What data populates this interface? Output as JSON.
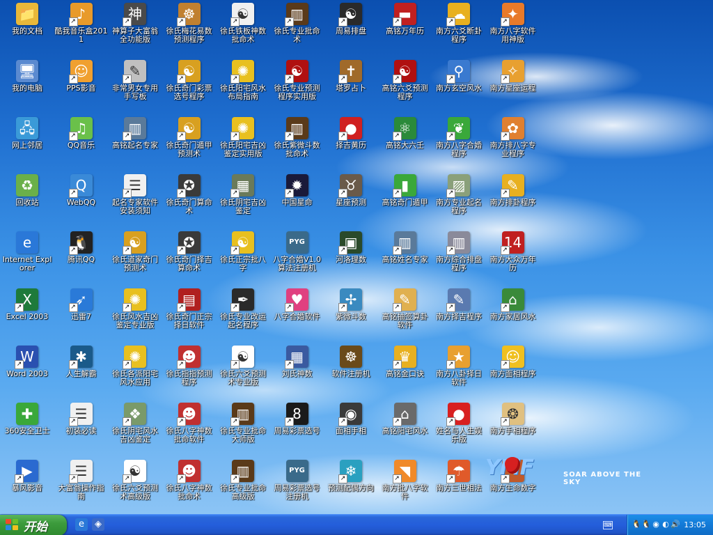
{
  "desktop": {
    "icons": [
      {
        "label": "我的文档",
        "glyph": "📁",
        "color": "#e8b83a",
        "col": 0,
        "row": 0,
        "shortcut": false
      },
      {
        "label": "我的电脑",
        "glyph": "🖥",
        "color": "#5a8ad0",
        "col": 0,
        "row": 1,
        "shortcut": false
      },
      {
        "label": "网上邻居",
        "glyph": "🖧",
        "color": "#3a9ad8",
        "col": 0,
        "row": 2,
        "shortcut": false
      },
      {
        "label": "回收站",
        "glyph": "♻",
        "color": "#6ab04a",
        "col": 0,
        "row": 3,
        "shortcut": false
      },
      {
        "label": "Internet Explorer",
        "glyph": "e",
        "color": "#2a78d8",
        "col": 0,
        "row": 4,
        "shortcut": false
      },
      {
        "label": "Excel 2003",
        "glyph": "X",
        "color": "#1e7a3a",
        "col": 0,
        "row": 5,
        "shortcut": true
      },
      {
        "label": "Word 2003",
        "glyph": "W",
        "color": "#2a50b0",
        "col": 0,
        "row": 6,
        "shortcut": true
      },
      {
        "label": "360安全卫士",
        "glyph": "✚",
        "color": "#3aa83a",
        "col": 0,
        "row": 7,
        "shortcut": false
      },
      {
        "label": "暴风影音",
        "glyph": "▶",
        "color": "#2a6ad0",
        "col": 0,
        "row": 8,
        "shortcut": true
      },
      {
        "label": "酷我音乐盒2011",
        "glyph": "♪",
        "color": "#e89a2a",
        "col": 1,
        "row": 0,
        "shortcut": true
      },
      {
        "label": "PPS影音",
        "glyph": "☺",
        "color": "#f0a030",
        "col": 1,
        "row": 1,
        "shortcut": true
      },
      {
        "label": "QQ音乐",
        "glyph": "♫",
        "color": "#6ac04a",
        "col": 1,
        "row": 2,
        "shortcut": true
      },
      {
        "label": "WebQQ",
        "glyph": "Q",
        "color": "#3a8ad8",
        "col": 1,
        "row": 3,
        "shortcut": true
      },
      {
        "label": "腾讯QQ",
        "glyph": "🐧",
        "color": "#222222",
        "col": 1,
        "row": 4,
        "shortcut": true
      },
      {
        "label": "迅雷7",
        "glyph": "➶",
        "color": "#2a7ad8",
        "col": 1,
        "row": 5,
        "shortcut": true
      },
      {
        "label": "人生解霸",
        "glyph": "✱",
        "color": "#1a5a8a",
        "col": 1,
        "row": 6,
        "shortcut": true
      },
      {
        "label": "初装必读",
        "glyph": "☰",
        "color": "#f0f0f0",
        "col": 1,
        "row": 7,
        "shortcut": true
      },
      {
        "label": "大富翁操作指南",
        "glyph": "☰",
        "color": "#f0f0f0",
        "col": 1,
        "row": 8,
        "shortcut": true
      },
      {
        "label": "神算子大富翁全功能版",
        "glyph": "神",
        "color": "#4a4a4a",
        "col": 2,
        "row": 0,
        "shortcut": true
      },
      {
        "label": "非常男女专用手写板",
        "glyph": "✎",
        "color": "#c0c0c0",
        "col": 2,
        "row": 1,
        "shortcut": true
      },
      {
        "label": "高铭起名专家",
        "glyph": "▥",
        "color": "#5a7a9a",
        "col": 2,
        "row": 2,
        "shortcut": true
      },
      {
        "label": "起名专家软件安装须知",
        "glyph": "☰",
        "color": "#f0f0f0",
        "col": 2,
        "row": 3,
        "shortcut": true
      },
      {
        "label": "徐氏道家奇门预测术",
        "glyph": "☯",
        "color": "#d8a020",
        "col": 2,
        "row": 4,
        "shortcut": true
      },
      {
        "label": "徐氏风水吉凶鉴定专业版",
        "glyph": "✺",
        "color": "#e8c020",
        "col": 2,
        "row": 5,
        "shortcut": true
      },
      {
        "label": "徐氏各派阳宅风水应用",
        "glyph": "✺",
        "color": "#e8c020",
        "col": 2,
        "row": 6,
        "shortcut": true
      },
      {
        "label": "徐氏阴宅风水吉凶鉴定",
        "glyph": "❖",
        "color": "#7a9a6a",
        "col": 2,
        "row": 7,
        "shortcut": true
      },
      {
        "label": "徐氏六爻预测术高级版",
        "glyph": "☯",
        "color": "#ffffff",
        "col": 2,
        "row": 8,
        "shortcut": true
      },
      {
        "label": "徐氏梅花易数预测程序",
        "glyph": "☸",
        "color": "#c08030",
        "col": 3,
        "row": 0,
        "shortcut": true
      },
      {
        "label": "徐氏奇门彩票选号程序",
        "glyph": "☯",
        "color": "#d8a020",
        "col": 3,
        "row": 1,
        "shortcut": true
      },
      {
        "label": "徐氏奇门遁甲预测术",
        "glyph": "☯",
        "color": "#d8a020",
        "col": 3,
        "row": 2,
        "shortcut": true
      },
      {
        "label": "徐氏奇门算命术",
        "glyph": "✪",
        "color": "#3a3a3a",
        "col": 3,
        "row": 3,
        "shortcut": true
      },
      {
        "label": "徐氏奇门择吉算命术",
        "glyph": "✪",
        "color": "#3a3a3a",
        "col": 3,
        "row": 4,
        "shortcut": true
      },
      {
        "label": "徐氏奇门正宗择日软件",
        "glyph": "▤",
        "color": "#b02020",
        "col": 3,
        "row": 5,
        "shortcut": true
      },
      {
        "label": "徐氏指指预测程序",
        "glyph": "☻",
        "color": "#c03030",
        "col": 3,
        "row": 6,
        "shortcut": true
      },
      {
        "label": "徐氏八字神数批命软件",
        "glyph": "☻",
        "color": "#c03030",
        "col": 3,
        "row": 7,
        "shortcut": true
      },
      {
        "label": "徐氏八字神数批命术",
        "glyph": "☻",
        "color": "#c03030",
        "col": 3,
        "row": 8,
        "shortcut": true
      },
      {
        "label": "徐氏铁板神数批命术",
        "glyph": "☯",
        "color": "#f0f0f0",
        "col": 4,
        "row": 0,
        "shortcut": true
      },
      {
        "label": "徐氏阳宅风水布局指南",
        "glyph": "✺",
        "color": "#e8c020",
        "col": 4,
        "row": 1,
        "shortcut": true
      },
      {
        "label": "徐氏阳宅吉凶鉴定实用版",
        "glyph": "✺",
        "color": "#e8c020",
        "col": 4,
        "row": 2,
        "shortcut": true
      },
      {
        "label": "徐氏阴宅吉凶鉴定",
        "glyph": "▦",
        "color": "#6a7a5a",
        "col": 4,
        "row": 3,
        "shortcut": true
      },
      {
        "label": "徐氏正宗批八字",
        "glyph": "☯",
        "color": "#e8c020",
        "col": 4,
        "row": 4,
        "shortcut": true
      },
      {
        "label": "徐氏专业改运起名程序",
        "glyph": "✒",
        "color": "#2a2a2a",
        "col": 4,
        "row": 5,
        "shortcut": true
      },
      {
        "label": "徐氏六爻预测术专业版",
        "glyph": "☯",
        "color": "#ffffff",
        "col": 4,
        "row": 6,
        "shortcut": true
      },
      {
        "label": "徐氏专业批命大师版",
        "glyph": "▥",
        "color": "#5a3a1a",
        "col": 4,
        "row": 7,
        "shortcut": true
      },
      {
        "label": "徐氏专业批命高级版",
        "glyph": "▥",
        "color": "#5a3a1a",
        "col": 4,
        "row": 8,
        "shortcut": true
      },
      {
        "label": "徐氏专业批命术",
        "glyph": "▥",
        "color": "#5a3a1a",
        "col": 5,
        "row": 0,
        "shortcut": true
      },
      {
        "label": "徐氏专业预测程序实用版",
        "glyph": "☯",
        "color": "#b01010",
        "col": 5,
        "row": 1,
        "shortcut": true
      },
      {
        "label": "徐氏紫微斗数批命术",
        "glyph": "▥",
        "color": "#5a3a1a",
        "col": 5,
        "row": 2,
        "shortcut": true
      },
      {
        "label": "中国星命",
        "glyph": "✹",
        "color": "#1a1a3a",
        "col": 5,
        "row": 3,
        "shortcut": true
      },
      {
        "label": "八字合婚V1.0算法注册机",
        "glyph": "PYG",
        "color": "#3a6a8a",
        "col": 5,
        "row": 4,
        "shortcut": false
      },
      {
        "label": "八字合婚软件",
        "glyph": "♥",
        "color": "#e04080",
        "col": 5,
        "row": 5,
        "shortcut": true
      },
      {
        "label": "刘氏神数",
        "glyph": "▦",
        "color": "#3a5aa0",
        "col": 5,
        "row": 6,
        "shortcut": true
      },
      {
        "label": "周易彩票选号",
        "glyph": "8",
        "color": "#1a1a1a",
        "col": 5,
        "row": 7,
        "shortcut": true
      },
      {
        "label": "周易彩票选号注册机",
        "glyph": "PYG",
        "color": "#3a6a8a",
        "col": 5,
        "row": 8,
        "shortcut": false
      },
      {
        "label": "周易排盘",
        "glyph": "☯",
        "color": "#2a2a2a",
        "col": 6,
        "row": 0,
        "shortcut": true
      },
      {
        "label": "塔罗占卜",
        "glyph": "✝",
        "color": "#a06a2a",
        "col": 6,
        "row": 1,
        "shortcut": true
      },
      {
        "label": "择吉黄历",
        "glyph": "●",
        "color": "#d02020",
        "col": 6,
        "row": 2,
        "shortcut": true
      },
      {
        "label": "星座预测",
        "glyph": "♉",
        "color": "#6a5a4a",
        "col": 6,
        "row": 3,
        "shortcut": true
      },
      {
        "label": "河洛理数",
        "glyph": "▣",
        "color": "#2a4a2a",
        "col": 6,
        "row": 4,
        "shortcut": true
      },
      {
        "label": "紫微斗数",
        "glyph": "✢",
        "color": "#3a8ac0",
        "col": 6,
        "row": 5,
        "shortcut": true
      },
      {
        "label": "软件注册机",
        "glyph": "☸",
        "color": "#6a4a1a",
        "col": 6,
        "row": 6,
        "shortcut": false
      },
      {
        "label": "面相手相",
        "glyph": "◉",
        "color": "#3a3a3a",
        "col": 6,
        "row": 7,
        "shortcut": true
      },
      {
        "label": "预测配偶方向",
        "glyph": "❄",
        "color": "#2aa0c0",
        "col": 6,
        "row": 8,
        "shortcut": true
      },
      {
        "label": "高铭万年历",
        "glyph": "▬",
        "color": "#c02020",
        "col": 7,
        "row": 0,
        "shortcut": true
      },
      {
        "label": "高铭六爻预测程序",
        "glyph": "☯",
        "color": "#b01010",
        "col": 7,
        "row": 1,
        "shortcut": true
      },
      {
        "label": "高铭大六壬",
        "glyph": "⚛",
        "color": "#2a8a3a",
        "col": 7,
        "row": 2,
        "shortcut": true
      },
      {
        "label": "高铭奇门遁甲",
        "glyph": "▮",
        "color": "#3aa83a",
        "col": 7,
        "row": 3,
        "shortcut": true
      },
      {
        "label": "高铭姓名专家",
        "glyph": "▥",
        "color": "#5a7a9a",
        "col": 7,
        "row": 4,
        "shortcut": true
      },
      {
        "label": "高铭抽签算卦软件",
        "glyph": "✎",
        "color": "#e0b050",
        "col": 7,
        "row": 5,
        "shortcut": true
      },
      {
        "label": "高铭金口诀",
        "glyph": "♛",
        "color": "#e8b020",
        "col": 7,
        "row": 6,
        "shortcut": true
      },
      {
        "label": "高铭阳宅风水",
        "glyph": "⌂",
        "color": "#6a6a6a",
        "col": 7,
        "row": 7,
        "shortcut": true
      },
      {
        "label": "南方批八字软件",
        "glyph": "◥",
        "color": "#f08a2a",
        "col": 7,
        "row": 8,
        "shortcut": true
      },
      {
        "label": "南方六爻断卦程序",
        "glyph": "☁",
        "color": "#e8b020",
        "col": 8,
        "row": 0,
        "shortcut": true
      },
      {
        "label": "南方玄空风水",
        "glyph": "⚲",
        "color": "#3a7ad0",
        "col": 8,
        "row": 1,
        "shortcut": true
      },
      {
        "label": "南方八字合婚程序",
        "glyph": "❦",
        "color": "#3aa83a",
        "col": 8,
        "row": 2,
        "shortcut": true
      },
      {
        "label": "南方专业起名程序",
        "glyph": "▨",
        "color": "#8aa07a",
        "col": 8,
        "row": 3,
        "shortcut": true
      },
      {
        "label": "南方综合排盘程序",
        "glyph": "▥",
        "color": "#8a8a9a",
        "col": 8,
        "row": 4,
        "shortcut": true
      },
      {
        "label": "南方择吉程序",
        "glyph": "✎",
        "color": "#5a7ab0",
        "col": 8,
        "row": 5,
        "shortcut": true
      },
      {
        "label": "南方八卦择日软件",
        "glyph": "★",
        "color": "#e8a030",
        "col": 8,
        "row": 6,
        "shortcut": true
      },
      {
        "label": "姓名与人生娱乐版",
        "glyph": "●",
        "color": "#d82020",
        "col": 8,
        "row": 7,
        "shortcut": true
      },
      {
        "label": "南方三世相法",
        "glyph": "☂",
        "color": "#e05a2a",
        "col": 8,
        "row": 8,
        "shortcut": true
      },
      {
        "label": "南方八字软件用神版",
        "glyph": "✦",
        "color": "#e87a2a",
        "col": 9,
        "row": 0,
        "shortcut": true
      },
      {
        "label": "南方星座运程",
        "glyph": "✧",
        "color": "#e8a030",
        "col": 9,
        "row": 1,
        "shortcut": true
      },
      {
        "label": "南方排八字专业程序",
        "glyph": "✿",
        "color": "#e08030",
        "col": 9,
        "row": 2,
        "shortcut": true
      },
      {
        "label": "南方排卦程序",
        "glyph": "✎",
        "color": "#e8b020",
        "col": 9,
        "row": 3,
        "shortcut": true
      },
      {
        "label": "南方大众万年历",
        "glyph": "14",
        "color": "#c02020",
        "col": 9,
        "row": 4,
        "shortcut": true
      },
      {
        "label": "南方家居风水",
        "glyph": "⌂",
        "color": "#3a8a3a",
        "col": 9,
        "row": 5,
        "shortcut": true
      },
      {
        "label": "南方面相程序",
        "glyph": "☺",
        "color": "#f0c020",
        "col": 9,
        "row": 6,
        "shortcut": true
      },
      {
        "label": "南方手相程序",
        "glyph": "❂",
        "color": "#e0c080",
        "col": 9,
        "row": 7,
        "shortcut": true
      },
      {
        "label": "南方生命数字",
        "glyph": "✎",
        "color": "#c05a2a",
        "col": 9,
        "row": 8,
        "shortcut": true
      }
    ]
  },
  "wallpaper_logo": {
    "mark": "YMF",
    "tagline": "SOAR ABOVE THE SKY"
  },
  "taskbar": {
    "start_label": "开始",
    "quick_launch": [
      {
        "icon": "ie-icon",
        "glyph": "e"
      },
      {
        "icon": "show-desktop-icon",
        "glyph": "◈"
      }
    ],
    "tray": {
      "icons": [
        {
          "icon": "qq-icon",
          "glyph": "🐧"
        },
        {
          "icon": "qq-icon",
          "glyph": "🐧"
        },
        {
          "icon": "antivirus-icon",
          "glyph": "◉"
        },
        {
          "icon": "network-icon",
          "glyph": "◐"
        },
        {
          "icon": "volume-icon",
          "glyph": "🔊"
        }
      ],
      "clock": "13:05"
    }
  }
}
